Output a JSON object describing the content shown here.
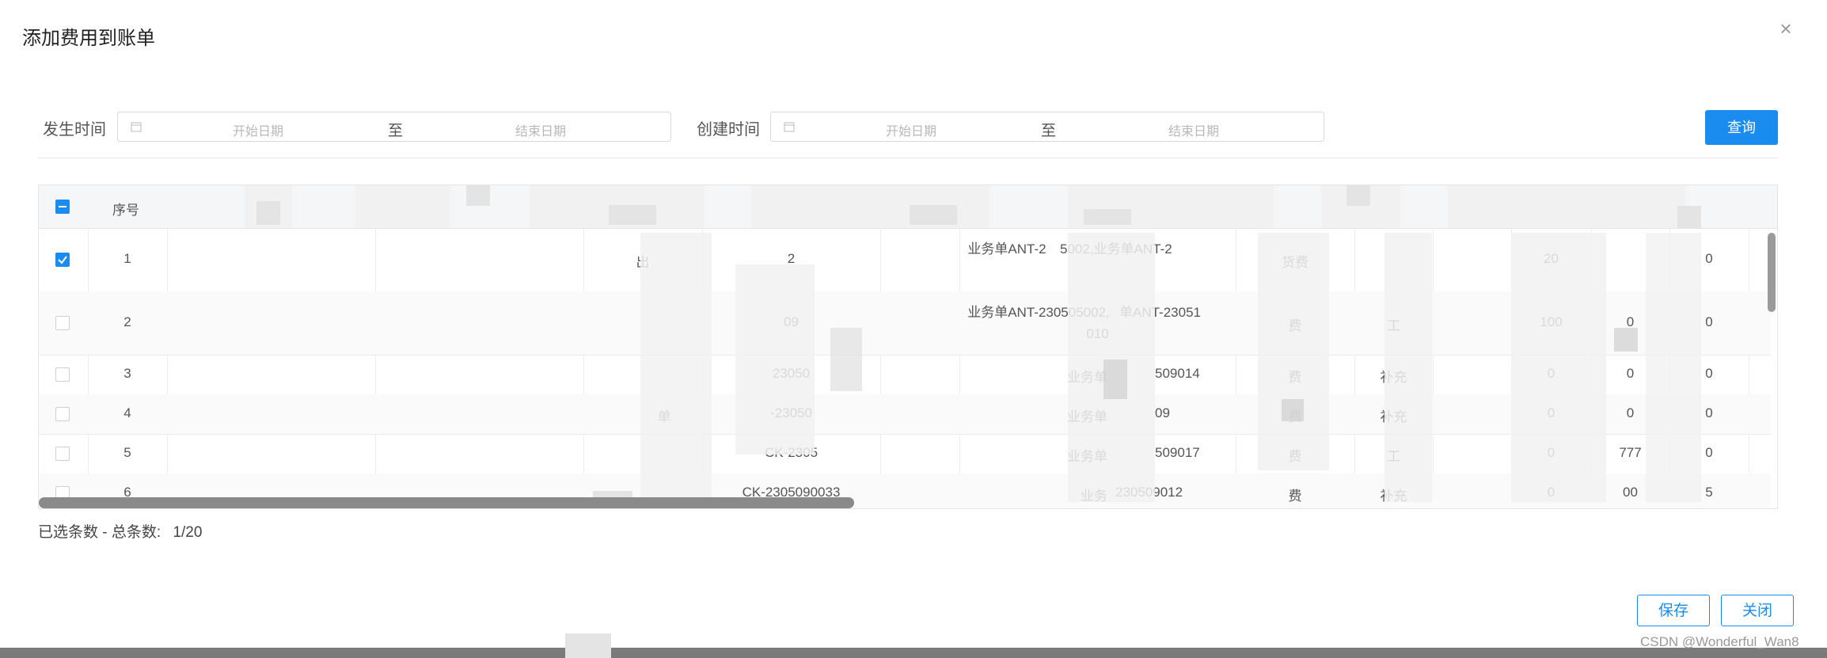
{
  "dialog": {
    "title": "添加费用到账单"
  },
  "filters": {
    "occur_label": "发生时间",
    "create_label": "创建时间",
    "start_placeholder": "开始日期",
    "end_placeholder": "结束日期",
    "separator": "至",
    "query_label": "查询"
  },
  "table": {
    "header_index": "序号",
    "rows": [
      {
        "index": "1",
        "checked": true,
        "c4": "出",
        "c5": "2",
        "c7": "业务单ANT-2",
        "c7a": "5002,业务单ANT-2",
        "c8": "货费",
        "c9": "",
        "c11": "20",
        "c12": "",
        "c13": "0"
      },
      {
        "index": "2",
        "checked": false,
        "c4": "",
        "c5": "09",
        "c7": "业务单ANT-230505002,",
        "c7a": "单ANT-23051",
        "c7b": "010",
        "c8": "费",
        "c9": "工",
        "c11": "100",
        "c12": "0",
        "c13": "0"
      },
      {
        "index": "3",
        "checked": false,
        "c4": "",
        "c5": "23050",
        "c7": "业务单",
        "c7a": "509014",
        "c8": "费",
        "c9": "补充",
        "c11": "0",
        "c12": "0",
        "c13": "0"
      },
      {
        "index": "4",
        "checked": false,
        "c4": "单",
        "c5": "-23050",
        "c7": "业务单",
        "c7a": "09",
        "c8": "费",
        "c9": "补充",
        "c11": "0",
        "c12": "0",
        "c13": "0"
      },
      {
        "index": "5",
        "checked": false,
        "c4": "",
        "c5": "CK-2305",
        "c7": "业务单",
        "c7a": "509017",
        "c8": "费",
        "c9": "工",
        "c11": "0",
        "c12": "777",
        "c13": "0"
      },
      {
        "index": "6",
        "checked": false,
        "c4": "",
        "c5": "CK-2305090033",
        "c7": "业务",
        "c7a": "230509012",
        "c8": "费",
        "c9": "补充",
        "c11": "0",
        "c12": "00",
        "c13": "5"
      }
    ]
  },
  "summary": {
    "label": "已选条数 - 总条数:",
    "value": "1/20"
  },
  "footer": {
    "save_label": "保存",
    "close_label": "关闭"
  },
  "watermark": "CSDN @Wonderful_Wan8",
  "colors": {
    "primary": "#1a8cf0"
  }
}
